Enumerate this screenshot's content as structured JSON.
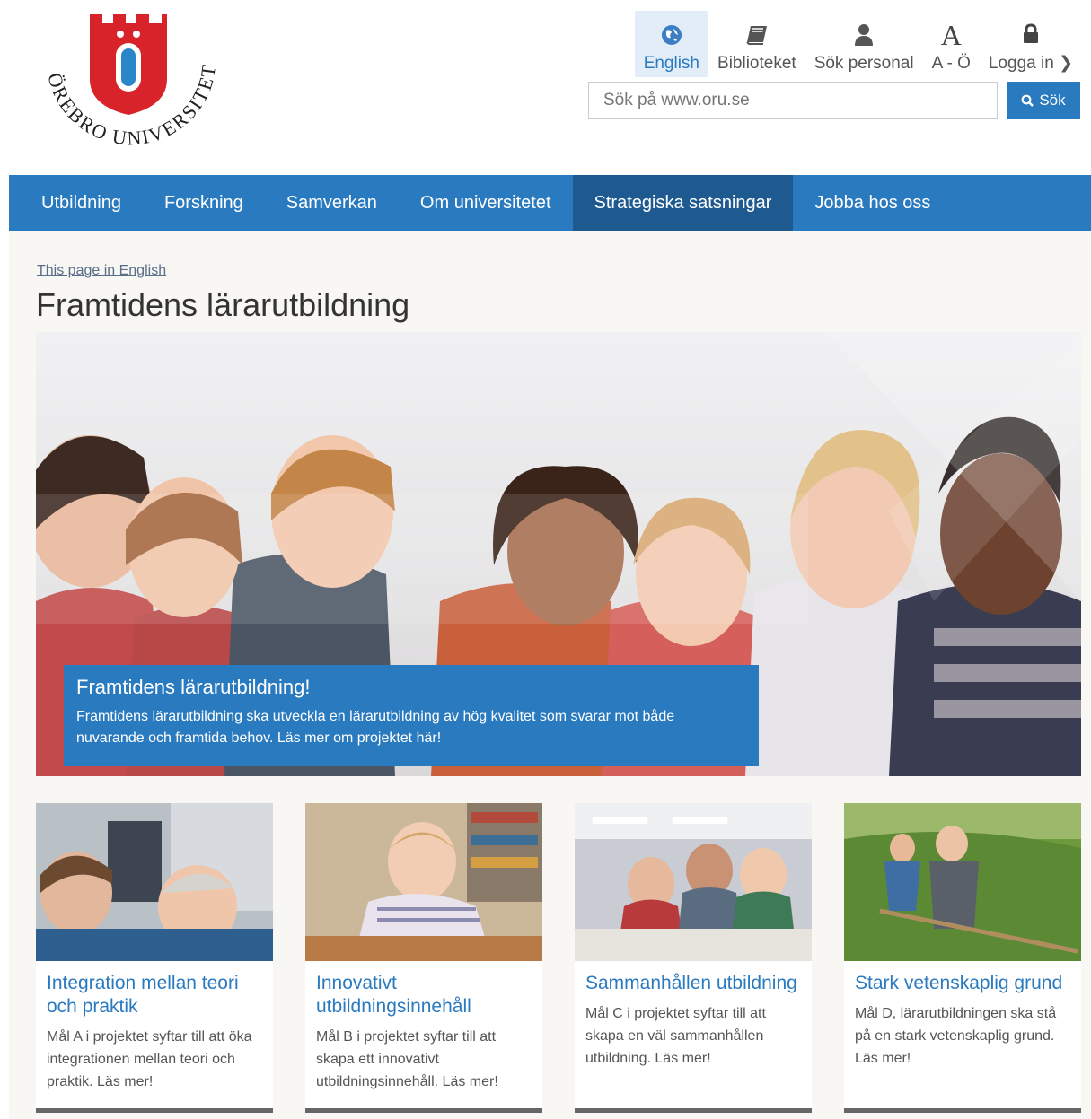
{
  "brand": {
    "name": "ÖREBRO UNIVERSITET",
    "letter": "Ö",
    "color": "#d8232a"
  },
  "utility": {
    "items": [
      {
        "label": "English",
        "icon": "globe-icon"
      },
      {
        "label": "Biblioteket",
        "icon": "book-icon"
      },
      {
        "label": "Sök personal",
        "icon": "person-icon"
      },
      {
        "label": "A - Ö",
        "icon": "letter-a-icon"
      },
      {
        "label": "Logga in",
        "icon": "lock-icon"
      }
    ]
  },
  "search": {
    "placeholder": "Sök på www.oru.se",
    "button_label": "Sök"
  },
  "nav": {
    "items": [
      "Utbildning",
      "Forskning",
      "Samverkan",
      "Om universitetet",
      "Strategiska satsningar",
      "Jobba hos oss"
    ],
    "active": "Strategiska satsningar"
  },
  "page": {
    "lang_link": "This page in English",
    "title": "Framtidens lärarutbildning"
  },
  "hero": {
    "heading": "Framtidens lärarutbildning!",
    "text": "Framtidens lärarutbildning ska utveckla en lärarutbildning av hög kvalitet som svarar mot både nuvarande och framtida behov. Läs mer om projektet här!"
  },
  "cards": [
    {
      "title": "Integration mellan teori och praktik",
      "text": "Mål A i projektet syftar till att öka integrationen mellan teori och praktik. Läs mer!"
    },
    {
      "title": "Innovativt utbildningsinnehåll",
      "text": "Mål B i projektet syftar till att skapa ett innovativt utbildningsinnehåll. Läs mer!"
    },
    {
      "title": "Sammanhållen utbildning",
      "text": "Mål C i projektet syftar till att skapa en väl sammanhållen utbildning. Läs mer!"
    },
    {
      "title": "Stark vetenskaplig grund",
      "text": "Mål D, lärarutbildningen ska stå på en stark vetenskaplig grund. Läs mer!"
    }
  ],
  "colors": {
    "primary": "#2a7ac0",
    "nav_active": "#1e5a90",
    "brand_red": "#d8232a"
  }
}
